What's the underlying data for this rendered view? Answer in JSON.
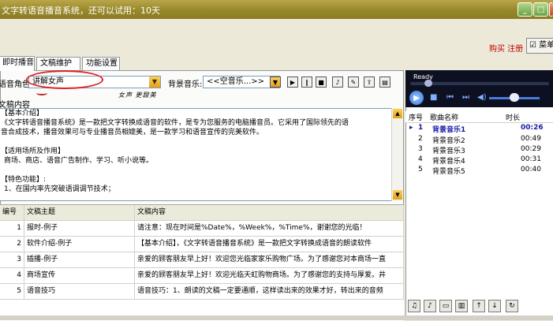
{
  "window": {
    "title": "文字转语音播音系统，还可以试用：10天",
    "minimize_glyph": "_",
    "maximize_glyph": "□",
    "close_glyph": "×"
  },
  "header": {
    "buy_register": "购买 注册",
    "menu_button": "菜单"
  },
  "tabs": [
    {
      "label": "即时播音"
    },
    {
      "label": "文稿维护"
    },
    {
      "label": "功能设置"
    }
  ],
  "voice": {
    "role_label": "语音角色:",
    "role_value": "讲解女声",
    "bg_music_label": "背景音乐:",
    "bg_music_value": "<<空音乐...>>",
    "handwritten_note": "女声 更甜美"
  },
  "content": {
    "label": "文稿内容",
    "lines": [
      "【基本介绍】",
      "《文字转语音播音系统》是一款把文字转换成语音的软件，是专为您服务的电脑播音员。它采用了国际领先的语",
      "音合成技术，播音效果可与专业播音员相媲美，是一款学习和语音宣传的完美软件。",
      "",
      "【适用场所及作用】",
      "商场、商店、语音广告制作、学习、听小说等。",
      "",
      "【特色功能】:",
      "1、在国内率先突破语调调节技术；"
    ]
  },
  "table": {
    "headers": [
      "编号",
      "文稿主题",
      "文稿内容"
    ],
    "rows": [
      {
        "id": "1",
        "topic": "报时-例子",
        "body": "请注意：现在时间是%Date%，%Week%，%Time%，谢谢您的光临！"
      },
      {
        "id": "2",
        "topic": "软件介绍-例子",
        "body": "【基本介绍】，《文字转语音播音系统》是一款把文字转换成语音的朗读软件"
      },
      {
        "id": "3",
        "topic": "插播-例子",
        "body": "亲爱的顾客朋友早上好！欢迎您光临家家乐购物广场。为了感谢您对本商场一直"
      },
      {
        "id": "4",
        "topic": "商场宣传",
        "body": "亲爱的顾客朋友早上好！欢迎光临天虹购物商场。为了感谢您的支持与厚爱。井"
      },
      {
        "id": "5",
        "topic": "语音技巧",
        "body": "语音技巧：1、朗读的文稿一定要通顺，这样读出来的效果才好，转出来的音频"
      }
    ]
  },
  "player": {
    "status": "Ready",
    "progress": 0.1,
    "volume": 0.5
  },
  "playlist": {
    "headers": [
      "序号",
      "歌曲名称",
      "时长"
    ],
    "items": [
      {
        "num": "1",
        "name": "背景音乐1",
        "duration": "00:26",
        "active": true
      },
      {
        "num": "2",
        "name": "背景音乐2",
        "duration": "00:49"
      },
      {
        "num": "3",
        "name": "背景音乐3",
        "duration": "00:29"
      },
      {
        "num": "4",
        "name": "背景音乐4",
        "duration": "00:31"
      },
      {
        "num": "5",
        "name": "背景音乐5",
        "duration": "00:40"
      }
    ]
  }
}
